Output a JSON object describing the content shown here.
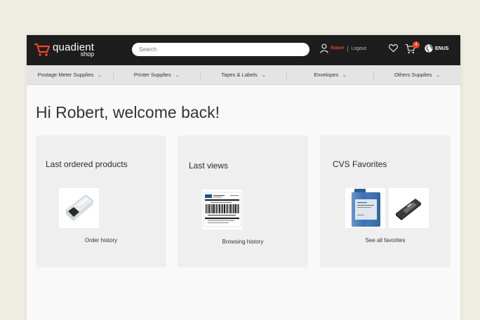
{
  "header": {
    "brand": "quadient",
    "brand_sub": "shop",
    "search_placeholder": "Search",
    "user_name": "Robert",
    "separator": "|",
    "logout": "Logout",
    "cart_count": "4",
    "language": "ENUS",
    "accent_color": "#e8472b"
  },
  "nav": {
    "items": [
      {
        "label": "Postage Meter Supplies"
      },
      {
        "label": "Printer Supplies"
      },
      {
        "label": "Tapes & Labels"
      },
      {
        "label": "Envelopes"
      },
      {
        "label": "Others Supplies"
      }
    ]
  },
  "main": {
    "greeting": "Hi Robert, welcome back!",
    "cards": [
      {
        "title": "Last ordered products",
        "link": "Order history"
      },
      {
        "title": "Last views",
        "link": "Browsing history"
      },
      {
        "title": "CVS Favorites",
        "link": "See all favorites"
      }
    ]
  }
}
